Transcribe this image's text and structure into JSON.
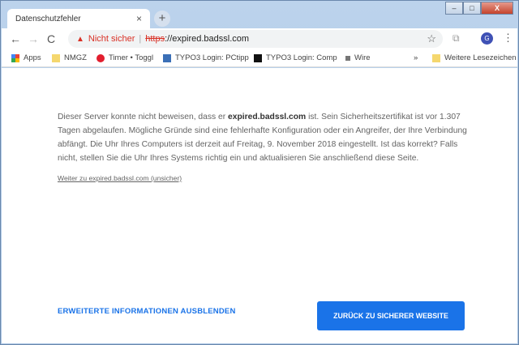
{
  "tab": {
    "title": "Datenschutzfehler",
    "close": "×",
    "new": "+"
  },
  "window": {
    "min": "–",
    "max": "□",
    "close": "X"
  },
  "toolbar": {
    "back": "←",
    "forward": "→",
    "reload": "C",
    "security": "Nicht sicher",
    "sep": "|",
    "scheme": "https",
    "rest": "://expired.badssl.com",
    "star": "☆",
    "avatar": "G",
    "menu": "⋮"
  },
  "bookmarks": {
    "items": [
      "Apps",
      "NMGZ",
      "Timer • Toggl",
      "TYPO3 Login: PCtipp",
      "TYPO3 Login: Comp",
      "Wire"
    ],
    "overflow": "»",
    "other": "Weitere Lesezeichen"
  },
  "page": {
    "p1": "Dieser Server konnte nicht beweisen, dass er ",
    "host": "expired.badssl.com",
    "p2": " ist. Sein Sicherheitszertifikat ist vor 1.307 Tagen abgelaufen. Mögliche Gründe sind eine fehlerhafte Konfiguration oder ein Angreifer, der Ihre Verbindung abfängt. Die Uhr Ihres Computers ist derzeit auf Freitag, 9. November 2018 eingestellt. Ist das korrekt? Falls nicht, stellen Sie die Uhr Ihres Systems richtig ein und aktualisieren Sie anschließend diese Seite.",
    "proceed": "Weiter zu expired.badssl.com (unsicher)",
    "hide_details": "ERWEITERTE INFORMATIONEN AUSBLENDEN",
    "back_safe": "ZURÜCK ZU SICHERER WEBSITE"
  }
}
